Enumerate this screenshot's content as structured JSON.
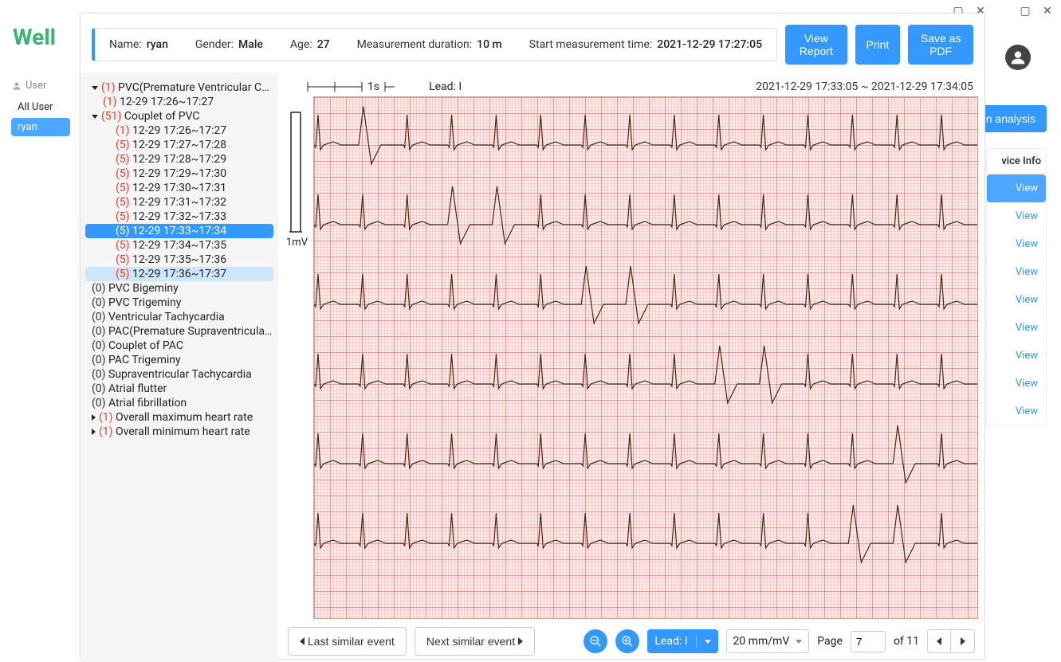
{
  "app": {
    "logo": "Well"
  },
  "sidebar": {
    "header_icon": "user-icon",
    "header_label": "User",
    "items": [
      {
        "label": "All User",
        "active": false
      },
      {
        "label": "ryan",
        "active": true
      }
    ]
  },
  "top_right": {
    "analysis_button": "n analysis"
  },
  "right_panel": {
    "header": "vice Info",
    "rows": [
      {
        "label": "View",
        "active": true
      },
      {
        "label": "View",
        "active": false
      },
      {
        "label": "View",
        "active": false
      },
      {
        "label": "View",
        "active": false
      },
      {
        "label": "View",
        "active": false
      },
      {
        "label": "View",
        "active": false
      },
      {
        "label": "View",
        "active": false
      },
      {
        "label": "View",
        "active": false
      },
      {
        "label": "View",
        "active": false
      }
    ]
  },
  "info": {
    "name_label": "Name:",
    "name": "ryan",
    "gender_label": "Gender:",
    "gender": "Male",
    "age_label": "Age:",
    "age": "27",
    "duration_label": "Measurement duration:",
    "duration": "10 m",
    "start_label": "Start measurement time:",
    "start": "2021-12-29 17:27:05"
  },
  "header_buttons": {
    "view_report": "View Report",
    "print": "Print",
    "save_pdf": "Save as PDF"
  },
  "tree": [
    {
      "level": 0,
      "caret": "down",
      "count": "(1)",
      "count_zero": false,
      "label": "PVC(Premature Ventricular Contr…"
    },
    {
      "level": 1,
      "caret": null,
      "count": "(1)",
      "count_zero": false,
      "label": "12-29 17:26~17:27"
    },
    {
      "level": 0,
      "caret": "down",
      "count": "(51)",
      "count_zero": false,
      "label": "Couplet of PVC"
    },
    {
      "level": 2,
      "caret": null,
      "count": "(1)",
      "count_zero": false,
      "label": "12-29 17:26~17:27"
    },
    {
      "level": 2,
      "caret": null,
      "count": "(5)",
      "count_zero": false,
      "label": "12-29 17:27~17:28"
    },
    {
      "level": 2,
      "caret": null,
      "count": "(5)",
      "count_zero": false,
      "label": "12-29 17:28~17:29"
    },
    {
      "level": 2,
      "caret": null,
      "count": "(5)",
      "count_zero": false,
      "label": "12-29 17:29~17:30"
    },
    {
      "level": 2,
      "caret": null,
      "count": "(5)",
      "count_zero": false,
      "label": "12-29 17:30~17:31"
    },
    {
      "level": 2,
      "caret": null,
      "count": "(5)",
      "count_zero": false,
      "label": "12-29 17:31~17:32"
    },
    {
      "level": 2,
      "caret": null,
      "count": "(5)",
      "count_zero": false,
      "label": "12-29 17:32~17:33"
    },
    {
      "level": 2,
      "caret": null,
      "count": "(5)",
      "count_zero": false,
      "label": "12-29 17:33~17:34",
      "selected": true
    },
    {
      "level": 2,
      "caret": null,
      "count": "(5)",
      "count_zero": false,
      "label": "12-29 17:34~17:35"
    },
    {
      "level": 2,
      "caret": null,
      "count": "(5)",
      "count_zero": false,
      "label": "12-29 17:35~17:36"
    },
    {
      "level": 2,
      "caret": null,
      "count": "(5)",
      "count_zero": false,
      "label": "12-29 17:36~17:37",
      "hover": true
    },
    {
      "level": 0,
      "caret": null,
      "count": "(0)",
      "count_zero": true,
      "label": "PVC Bigeminy"
    },
    {
      "level": 0,
      "caret": null,
      "count": "(0)",
      "count_zero": true,
      "label": "PVC Trigeminy"
    },
    {
      "level": 0,
      "caret": null,
      "count": "(0)",
      "count_zero": true,
      "label": "Ventricular Tachycardia"
    },
    {
      "level": 0,
      "caret": null,
      "count": "(0)",
      "count_zero": true,
      "label": "PAC(Premature Supraventricular …"
    },
    {
      "level": 0,
      "caret": null,
      "count": "(0)",
      "count_zero": true,
      "label": "Couplet of PAC"
    },
    {
      "level": 0,
      "caret": null,
      "count": "(0)",
      "count_zero": true,
      "label": "PAC Trigeminy"
    },
    {
      "level": 0,
      "caret": null,
      "count": "(0)",
      "count_zero": true,
      "label": "Supraventricular Tachycardia"
    },
    {
      "level": 0,
      "caret": null,
      "count": "(0)",
      "count_zero": true,
      "label": "Atrial flutter"
    },
    {
      "level": 0,
      "caret": null,
      "count": "(0)",
      "count_zero": true,
      "label": "Atrial fibrillation"
    },
    {
      "level": 0,
      "caret": "right",
      "count": "(1)",
      "count_zero": false,
      "label": "Overall maximum heart rate"
    },
    {
      "level": 0,
      "caret": "right",
      "count": "(1)",
      "count_zero": false,
      "label": "Overall minimum heart rate"
    }
  ],
  "ecg": {
    "scale_text": "1s",
    "lead_label_text": "Lead: I",
    "time_range": "2021-12-29 17:33:05 ~ 2021-12-29 17:34:05",
    "mv_label": "1mV"
  },
  "footer": {
    "prev_event": "Last similar event",
    "next_event": "Next similar event",
    "lead_select": "Lead: I",
    "gain_select": "20 mm/mV",
    "page_label": "Page",
    "page_value": "7",
    "of_label": "of 11"
  }
}
